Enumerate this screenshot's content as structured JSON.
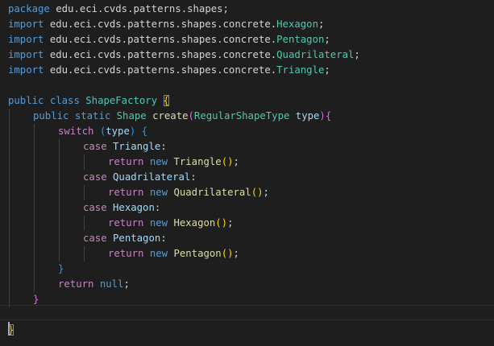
{
  "editor": {
    "language": "java",
    "colors": {
      "background": "#1e1e1e",
      "keyword": "#569cd6",
      "control": "#c586c0",
      "type": "#4ec9b0",
      "function": "#dcdcaa",
      "variable": "#9cdcfe",
      "text": "#d4d4d4",
      "bracket_gold": "#ffd700",
      "bracket_purple": "#da70d6",
      "bracket_blue": "#179fff"
    },
    "lines": [
      {
        "indent": 0,
        "tokens": [
          {
            "t": "package",
            "c": "keyword"
          },
          {
            "t": " edu.eci.cvds.patterns.shapes;",
            "c": "text"
          }
        ]
      },
      {
        "indent": 0,
        "tokens": [
          {
            "t": "import",
            "c": "keyword"
          },
          {
            "t": " edu.eci.cvds.patterns.shapes.concrete.",
            "c": "text"
          },
          {
            "t": "Hexagon",
            "c": "type"
          },
          {
            "t": ";",
            "c": "text"
          }
        ]
      },
      {
        "indent": 0,
        "tokens": [
          {
            "t": "import",
            "c": "keyword"
          },
          {
            "t": " edu.eci.cvds.patterns.shapes.concrete.",
            "c": "text"
          },
          {
            "t": "Pentagon",
            "c": "type"
          },
          {
            "t": ";",
            "c": "text"
          }
        ]
      },
      {
        "indent": 0,
        "tokens": [
          {
            "t": "import",
            "c": "keyword"
          },
          {
            "t": " edu.eci.cvds.patterns.shapes.concrete.",
            "c": "text"
          },
          {
            "t": "Quadrilateral",
            "c": "type"
          },
          {
            "t": ";",
            "c": "text"
          }
        ]
      },
      {
        "indent": 0,
        "tokens": [
          {
            "t": "import",
            "c": "keyword"
          },
          {
            "t": " edu.eci.cvds.patterns.shapes.concrete.",
            "c": "text"
          },
          {
            "t": "Triangle",
            "c": "type"
          },
          {
            "t": ";",
            "c": "text"
          }
        ]
      },
      {
        "indent": 0,
        "tokens": []
      },
      {
        "indent": 0,
        "tokens": [
          {
            "t": "public",
            "c": "keyword"
          },
          {
            "t": " ",
            "c": "text"
          },
          {
            "t": "class",
            "c": "keyword"
          },
          {
            "t": " ",
            "c": "text"
          },
          {
            "t": "ShapeFactory",
            "c": "type"
          },
          {
            "t": " ",
            "c": "text"
          },
          {
            "t": "{",
            "c": "bracket_gold",
            "box": true
          }
        ]
      },
      {
        "indent": 1,
        "tokens": [
          {
            "t": "public",
            "c": "keyword"
          },
          {
            "t": " ",
            "c": "text"
          },
          {
            "t": "static",
            "c": "keyword"
          },
          {
            "t": " ",
            "c": "text"
          },
          {
            "t": "Shape",
            "c": "type"
          },
          {
            "t": " ",
            "c": "text"
          },
          {
            "t": "create",
            "c": "function"
          },
          {
            "t": "(",
            "c": "bracket_purple"
          },
          {
            "t": "RegularShapeType",
            "c": "type"
          },
          {
            "t": " ",
            "c": "text"
          },
          {
            "t": "type",
            "c": "variable"
          },
          {
            "t": ")",
            "c": "bracket_purple"
          },
          {
            "t": "{",
            "c": "bracket_purple"
          }
        ]
      },
      {
        "indent": 2,
        "tokens": [
          {
            "t": "switch",
            "c": "control"
          },
          {
            "t": " ",
            "c": "text"
          },
          {
            "t": "(",
            "c": "bracket_blue"
          },
          {
            "t": "type",
            "c": "variable"
          },
          {
            "t": ")",
            "c": "bracket_blue"
          },
          {
            "t": " ",
            "c": "text"
          },
          {
            "t": "{",
            "c": "bracket_blue"
          }
        ]
      },
      {
        "indent": 3,
        "tokens": [
          {
            "t": "case",
            "c": "control"
          },
          {
            "t": " ",
            "c": "text"
          },
          {
            "t": "Triangle",
            "c": "variable"
          },
          {
            "t": ":",
            "c": "text"
          }
        ]
      },
      {
        "indent": 4,
        "tokens": [
          {
            "t": "return",
            "c": "control"
          },
          {
            "t": " ",
            "c": "text"
          },
          {
            "t": "new",
            "c": "keyword"
          },
          {
            "t": " ",
            "c": "text"
          },
          {
            "t": "Triangle",
            "c": "function"
          },
          {
            "t": "()",
            "c": "bracket_gold"
          },
          {
            "t": ";",
            "c": "text"
          }
        ]
      },
      {
        "indent": 3,
        "tokens": [
          {
            "t": "case",
            "c": "control"
          },
          {
            "t": " ",
            "c": "text"
          },
          {
            "t": "Quadrilateral",
            "c": "variable"
          },
          {
            "t": ":",
            "c": "text"
          }
        ]
      },
      {
        "indent": 4,
        "tokens": [
          {
            "t": "return",
            "c": "control"
          },
          {
            "t": " ",
            "c": "text"
          },
          {
            "t": "new",
            "c": "keyword"
          },
          {
            "t": " ",
            "c": "text"
          },
          {
            "t": "Quadrilateral",
            "c": "function"
          },
          {
            "t": "()",
            "c": "bracket_gold"
          },
          {
            "t": ";",
            "c": "text"
          }
        ]
      },
      {
        "indent": 3,
        "tokens": [
          {
            "t": "case",
            "c": "control"
          },
          {
            "t": " ",
            "c": "text"
          },
          {
            "t": "Hexagon",
            "c": "variable"
          },
          {
            "t": ":",
            "c": "text"
          }
        ]
      },
      {
        "indent": 4,
        "tokens": [
          {
            "t": "return",
            "c": "control"
          },
          {
            "t": " ",
            "c": "text"
          },
          {
            "t": "new",
            "c": "keyword"
          },
          {
            "t": " ",
            "c": "text"
          },
          {
            "t": "Hexagon",
            "c": "function"
          },
          {
            "t": "()",
            "c": "bracket_gold"
          },
          {
            "t": ";",
            "c": "text"
          }
        ]
      },
      {
        "indent": 3,
        "tokens": [
          {
            "t": "case",
            "c": "control"
          },
          {
            "t": " ",
            "c": "text"
          },
          {
            "t": "Pentagon",
            "c": "variable"
          },
          {
            "t": ":",
            "c": "text"
          }
        ]
      },
      {
        "indent": 4,
        "tokens": [
          {
            "t": "return",
            "c": "control"
          },
          {
            "t": " ",
            "c": "text"
          },
          {
            "t": "new",
            "c": "keyword"
          },
          {
            "t": " ",
            "c": "text"
          },
          {
            "t": "Pentagon",
            "c": "function"
          },
          {
            "t": "()",
            "c": "bracket_gold"
          },
          {
            "t": ";",
            "c": "text"
          }
        ]
      },
      {
        "indent": 2,
        "tokens": [
          {
            "t": "}",
            "c": "bracket_blue"
          }
        ]
      },
      {
        "indent": 2,
        "tokens": [
          {
            "t": "return",
            "c": "control"
          },
          {
            "t": " ",
            "c": "text"
          },
          {
            "t": "null",
            "c": "keyword"
          },
          {
            "t": ";",
            "c": "text"
          }
        ]
      },
      {
        "indent": 1,
        "tokens": [
          {
            "t": "}",
            "c": "bracket_purple"
          }
        ]
      },
      {
        "indent": 0,
        "tokens": []
      },
      {
        "indent": 0,
        "tokens": [
          {
            "t": "}",
            "c": "bracket_gold",
            "box": true
          }
        ]
      }
    ]
  }
}
